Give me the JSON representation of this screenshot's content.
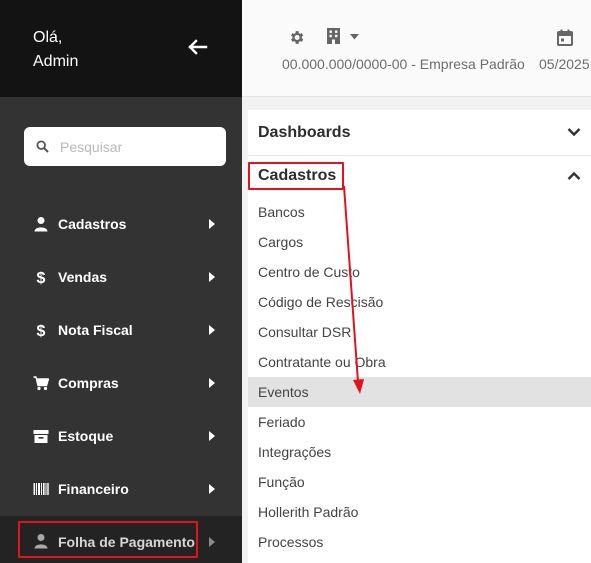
{
  "sidebar": {
    "greeting_line1": "Olá,",
    "greeting_line2": "Admin",
    "back_icon": "arrow-left-icon",
    "search": {
      "placeholder": "Pesquisar",
      "icon": "search-icon"
    },
    "items": [
      {
        "label": "Cadastros",
        "icon": "user-icon"
      },
      {
        "label": "Vendas",
        "icon": "dollar-icon"
      },
      {
        "label": "Nota Fiscal",
        "icon": "dollar-icon"
      },
      {
        "label": "Compras",
        "icon": "cart-icon"
      },
      {
        "label": "Estoque",
        "icon": "archive-icon"
      },
      {
        "label": "Financeiro",
        "icon": "barcode-icon"
      },
      {
        "label": "Folha de Pagamento",
        "icon": "user-icon"
      }
    ]
  },
  "topbar": {
    "company": "00.000.000/0000-00 - Empresa Padrão",
    "period": "05/2025",
    "icons": [
      "gear-icon",
      "building-icon",
      "caret-down-icon",
      "calendar-icon"
    ]
  },
  "menu": {
    "sections": [
      {
        "label": "Dashboards",
        "expanded": false
      },
      {
        "label": "Cadastros",
        "expanded": true
      }
    ],
    "items": [
      "Bancos",
      "Cargos",
      "Centro de Custo",
      "Código de Rescisão",
      "Consultar DSR",
      "Contratante ou Obra",
      "Eventos",
      "Feriado",
      "Integrações",
      "Função",
      "Hollerith Padrão",
      "Processos"
    ],
    "hovered_item": "Eventos"
  },
  "colors": {
    "sidebar_bg": "#333333",
    "sidebar_header_bg": "#131313",
    "highlight": "#e2131c",
    "hover_bg": "#e2e2e2"
  }
}
